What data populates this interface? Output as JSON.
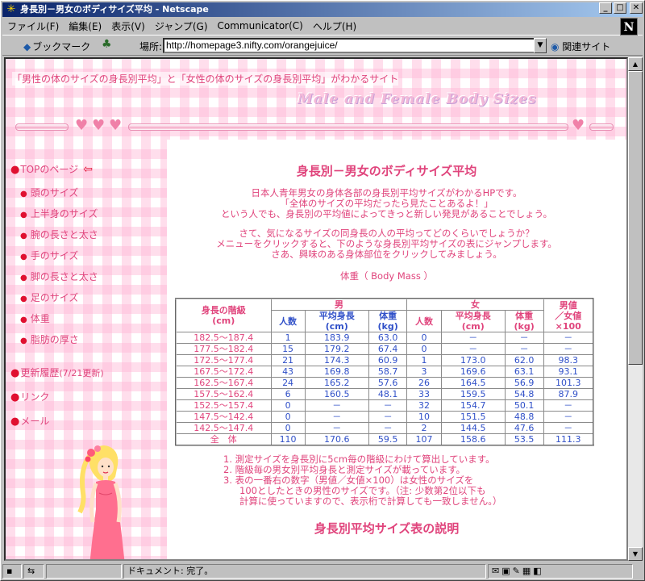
{
  "window": {
    "title": "身長別－男女のボディサイズ平均 - Netscape",
    "buttons": {
      "minimize": "_",
      "maximize": "□",
      "close": "✕"
    }
  },
  "menu": [
    "ファイル(F)",
    "編集(E)",
    "表示(V)",
    "ジャンプ(G)",
    "Communicator(C)",
    "ヘルプ(H)"
  ],
  "toolbar": {
    "bookmarks_label": "ブックマーク",
    "location_label": "場所:",
    "url": "http://homepage3.nifty.com/orangejuice/",
    "related_label": "関連サイト",
    "logo": "N"
  },
  "page": {
    "tagline": "「男性の体のサイズの身長別平均」と「女性の体のサイズの身長別平均」がわかるサイト",
    "logo_text": "Male and Female Body Sizes",
    "nav": {
      "top": "TOPのページ",
      "items": [
        "頭のサイズ",
        "上半身のサイズ",
        "腕の長さと太さ",
        "手のサイズ",
        "脚の長さと太さ",
        "足のサイズ",
        "体重",
        "脂肪の厚さ"
      ],
      "history_main": "更新履歴",
      "history_sub": "(7/21更新)",
      "links": "リンク",
      "mail": "メール"
    },
    "content": {
      "title": "身長別－男女のボディサイズ平均",
      "intro": [
        "日本人青年男女の身体各部の身長別平均サイズがわかるHPです。",
        "「全体のサイズの平均だったら見たことあるよ！」",
        "という人でも、身長別の平均値によってきっと新しい発見があることでしょう。"
      ],
      "prompt": [
        "さて、気になるサイズの同身長の人の平均ってどのくらいでしょうか？",
        "メニューをクリックすると、下のような身長別平均サイズの表にジャンプします。",
        "さあ、興味のある身体部位をクリックしてみましょう。"
      ],
      "table_caption": "体重（ Body Mass ）",
      "table": {
        "header_height": "身長の階級\n(cm)",
        "header_male": "男",
        "header_female": "女",
        "header_ratio": "男値\n／女値\n×100",
        "sub_headers": [
          "人数",
          "平均身長\n(cm)",
          "体重\n(kg)",
          "人数",
          "平均身長\n(cm)",
          "体重\n(kg)"
        ],
        "rows": [
          [
            "182.5～187.4",
            "1",
            "183.9",
            "63.0",
            "0",
            "－",
            "－",
            "－"
          ],
          [
            "177.5～182.4",
            "15",
            "179.2",
            "67.4",
            "0",
            "－",
            "－",
            "－"
          ],
          [
            "172.5～177.4",
            "21",
            "174.3",
            "60.9",
            "1",
            "173.0",
            "62.0",
            "98.3"
          ],
          [
            "167.5～172.4",
            "43",
            "169.8",
            "58.7",
            "3",
            "169.6",
            "63.1",
            "93.1"
          ],
          [
            "162.5～167.4",
            "24",
            "165.2",
            "57.6",
            "26",
            "164.5",
            "56.9",
            "101.3"
          ],
          [
            "157.5～162.4",
            "6",
            "160.5",
            "48.1",
            "33",
            "159.5",
            "54.8",
            "87.9"
          ],
          [
            "152.5～157.4",
            "0",
            "－",
            "－",
            "32",
            "154.7",
            "50.1",
            "－"
          ],
          [
            "147.5～142.4",
            "0",
            "－",
            "－",
            "10",
            "151.5",
            "48.8",
            "－"
          ],
          [
            "142.5～147.4",
            "0",
            "－",
            "－",
            "2",
            "144.5",
            "47.6",
            "－"
          ],
          [
            "全　体",
            "110",
            "170.6",
            "59.5",
            "107",
            "158.6",
            "53.5",
            "111.3"
          ]
        ]
      },
      "explain_title": "身長別平均サイズ表の説明",
      "notes": [
        "1. 測定サイズを身長別に5cm毎の階級にわけて算出しています。",
        "2. 階級毎の男女別平均身長と測定サイズが載っています。",
        "3. 表の一番右の数字（男値／女値×100）は女性のサイズを",
        "100としたときの男性のサイズです。（注: 少数第2位以下も",
        "計算に使っていますので、表示桁で計算しても一致しません。）"
      ]
    }
  },
  "status": {
    "text": "ドキュメント: 完了。"
  }
}
